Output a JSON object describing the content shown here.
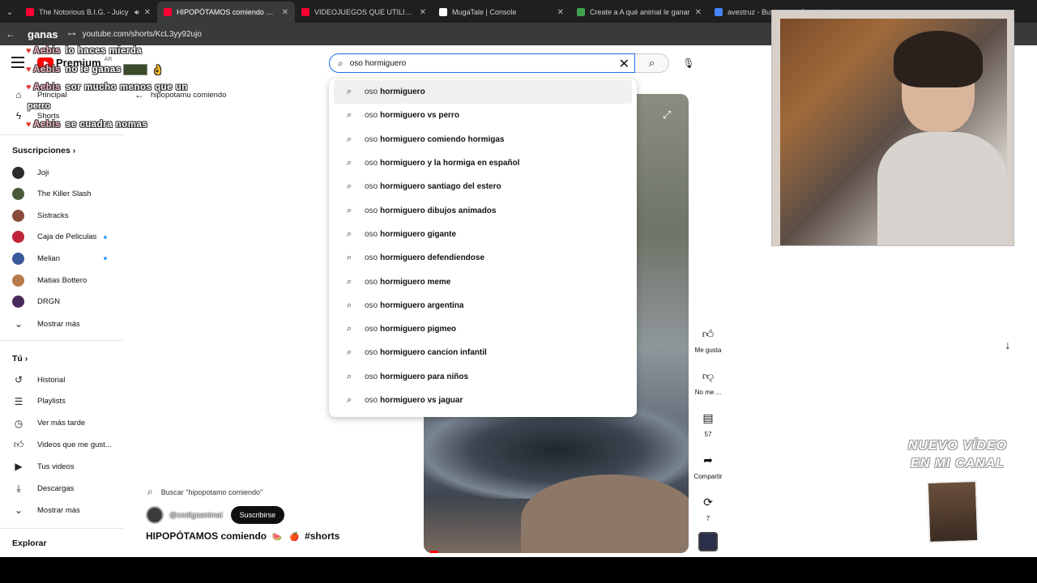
{
  "browser": {
    "tabs": [
      {
        "title": "The Notorious B.I.G. - Juicy",
        "color": "#ff0033",
        "audio": true
      },
      {
        "title": "HIPOPÓTAMOS comiendo 🍉🍎",
        "color": "#ff0033",
        "active": true
      },
      {
        "title": "VIDEOJUEGOS QUE UTILIZARON",
        "color": "#ff0033"
      },
      {
        "title": "MugaTale | Console",
        "color": "#ffffff"
      },
      {
        "title": "Create a A qué animal le ganar",
        "color": "#3fa34d"
      },
      {
        "title": "avestruz - Buscar con Google",
        "color": "#4285f4"
      }
    ],
    "address_word": "ganas",
    "url": "youtube.com/shorts/KcL3yy92ujo"
  },
  "masthead": {
    "brand": "Premium",
    "country": "AR",
    "search_value": "oso hormiguero",
    "clear_icon": "close-icon",
    "search_icon": "search-icon",
    "mic_icon": "mic-icon"
  },
  "suggestions": [
    {
      "prefix": "oso",
      "rest": "hormiguero"
    },
    {
      "prefix": "oso",
      "rest": "hormiguero vs perro"
    },
    {
      "prefix": "oso",
      "rest": "hormiguero comiendo hormigas"
    },
    {
      "prefix": "oso",
      "rest": "hormiguero y la hormiga en español"
    },
    {
      "prefix": "oso",
      "rest": "hormiguero santiago del estero"
    },
    {
      "prefix": "oso",
      "rest": "hormiguero dibujos animados"
    },
    {
      "prefix": "oso",
      "rest": "hormiguero gigante"
    },
    {
      "prefix": "oso",
      "rest": "hormiguero defendiendose"
    },
    {
      "prefix": "oso",
      "rest": "hormiguero meme"
    },
    {
      "prefix": "oso",
      "rest": "hormiguero argentina"
    },
    {
      "prefix": "oso",
      "rest": "hormiguero pigmeo"
    },
    {
      "prefix": "oso",
      "rest": "hormiguero cancion infantil"
    },
    {
      "prefix": "oso",
      "rest": "hormiguero para niños"
    },
    {
      "prefix": "oso",
      "rest": "hormiguero vs jaguar"
    }
  ],
  "sidebar": {
    "home": "Principal",
    "shorts": "Shorts",
    "subs_header": "Suscripciones",
    "subscriptions": [
      {
        "name": "Joji",
        "color": "#2d2d2d",
        "dot": false
      },
      {
        "name": "The Killer Slash",
        "color": "#4a5a3a",
        "dot": false
      },
      {
        "name": "Sistracks",
        "color": "#8a4a3a",
        "dot": false
      },
      {
        "name": "Caja de Peliculas",
        "color": "#c0243a",
        "dot": true
      },
      {
        "name": "Melian",
        "color": "#3a5a9a",
        "dot": true
      },
      {
        "name": "Matias Bottero",
        "color": "#b87a4a",
        "dot": false
      },
      {
        "name": "DRGN",
        "color": "#4a2a5a",
        "dot": false
      }
    ],
    "show_more": "Mostrar más",
    "you_header": "Tú",
    "you_items": [
      {
        "label": "Historial",
        "icon": "history-icon"
      },
      {
        "label": "Playlists",
        "icon": "playlist-icon"
      },
      {
        "label": "Ver más tarde",
        "icon": "clock-icon"
      },
      {
        "label": "Videos que me gust...",
        "icon": "thumb-up-icon"
      },
      {
        "label": "Tus videos",
        "icon": "video-icon"
      },
      {
        "label": "Descargas",
        "icon": "download-icon"
      }
    ],
    "show_more_2": "Mostrar más",
    "explore": "Explorar"
  },
  "chat_overlay": [
    {
      "user": "Aebis",
      "text": "lo haces mierda"
    },
    {
      "user": "Aebis",
      "text": "no le ganas"
    },
    {
      "user": "Aebis",
      "text": "sor mucho menos que un"
    },
    {
      "user": "",
      "text": "perro"
    },
    {
      "user": "Aebis",
      "text": "se cuadra nomas"
    }
  ],
  "short": {
    "back_label": "hipopotamu comiendo",
    "channel_search": "Buscar \"hipopotamo comiendo\"",
    "channel": "@codigoanimal",
    "subscribe": "Suscribirse",
    "title": "HIPOPÓTAMOS comiendo",
    "hashtag": "#shorts",
    "actions": {
      "like": "Me gusta",
      "dislike": "No me ...",
      "comments": "57",
      "share": "Compartir",
      "remix": "7"
    }
  },
  "promo": {
    "line1": "NUEVO VÍDEO",
    "line2": "EN MI CANAL"
  }
}
